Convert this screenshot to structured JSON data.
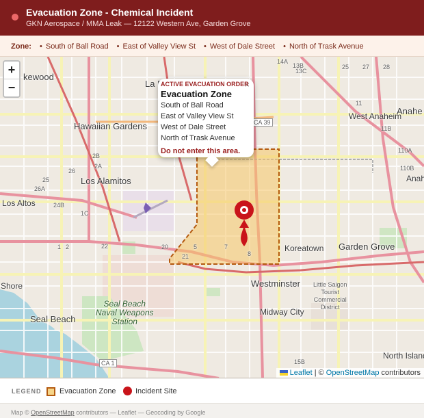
{
  "header": {
    "title": "Evacuation Zone - Chemical Incident",
    "subtitle": "GKN Aerospace / MMA Leak — 12122 Western Ave, Garden Grove"
  },
  "zone_bar": {
    "label": "Zone:",
    "items": [
      "South of Ball Road",
      "East of Valley View St",
      "West of Dale Street",
      "North of Trask Avenue"
    ]
  },
  "map": {
    "zoom_in": "+",
    "zoom_out": "−",
    "place_labels": {
      "lakewood": "kewood",
      "la_palma": "La P",
      "anaheim": "Anahe",
      "hawaiian_gardens": "Hawaiian Gardens",
      "west_anaheim": "West Anaheim",
      "los_alamitos": "Los Alamitos",
      "los_altos": "Los Altos",
      "anaheim2": "Anah",
      "garden_grove": "Garden Grove",
      "koreatown": "Koreatown",
      "westminster": "Westminster",
      "little_saigon": "Little Saigon\nTourist\nCommercial\nDistrict",
      "shore": "Shore",
      "seal_beach_base": "Seal Beach\nNaval Weapons\nStation",
      "seal_beach": "Seal Beach",
      "midway_city": "Midway City",
      "north_island": "North Island",
      "ca39": "CA 39",
      "ca1": "CA 1"
    },
    "route_labels": [
      "14A",
      "13B",
      "13C",
      "25",
      "27",
      "28",
      "11",
      "11B",
      "110A",
      "110B",
      "2B",
      "2A",
      "26",
      "25",
      "26A",
      "24B",
      "1C",
      "22",
      "20",
      "21",
      "5",
      "7",
      "8",
      "15B",
      "1",
      "2"
    ],
    "popup": {
      "order": "ACTIVE EVACUATION ORDER",
      "title": "Evacuation Zone",
      "lines": [
        "South of Ball Road",
        "East of Valley View St",
        "West of Dale Street",
        "North of Trask Avenue"
      ],
      "warning": "Do not enter this area.",
      "close": "×"
    },
    "attribution": {
      "leaflet": "Leaflet",
      "separator": "|",
      "copyright": "©",
      "osm": "OpenStreetMap",
      "contributors": "contributors"
    },
    "colors": {
      "zone_fill": "#f6c667",
      "zone_border": "#b45a10",
      "incident_marker": "#c9141a",
      "header_bg": "#7f1d1d"
    }
  },
  "legend": {
    "title": "LEGEND",
    "zone_label": "Evacuation Zone",
    "site_label": "Incident Site"
  },
  "footer": {
    "prefix": "Map ©",
    "osm": "OpenStreetMap",
    "rest": "contributors — Leaflet — Geocoding by Google"
  }
}
